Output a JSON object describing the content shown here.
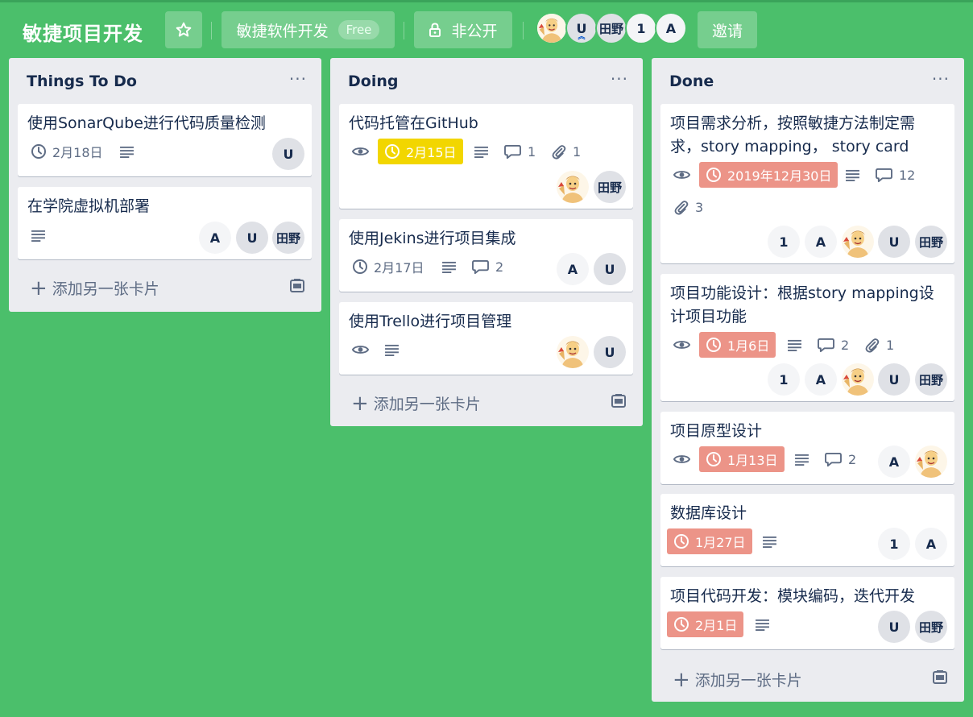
{
  "header": {
    "board_title": "敏捷项目开发",
    "star_icon": "star-icon",
    "team_name": "敏捷软件开发",
    "team_plan": "Free",
    "visibility": "非公开",
    "members": [
      "U",
      "田野",
      "1",
      "A"
    ],
    "invite_label": "邀请"
  },
  "lists": [
    {
      "title": "Things To Do",
      "menu": "···",
      "add_card": "添加另一张卡片",
      "cards": [
        {
          "title": "使用SonarQube进行代码质量检测",
          "due": "2月18日",
          "members": [
            "U"
          ]
        },
        {
          "title": "在学院虚拟机部署",
          "members": [
            "A",
            "U",
            "田野"
          ]
        }
      ]
    },
    {
      "title": "Doing",
      "menu": "···",
      "add_card": "添加另一张卡片",
      "cards": [
        {
          "title": "代码托管在GitHub",
          "due": "2月15日",
          "comments": "1",
          "attachments": "1",
          "members": [
            "田野"
          ]
        },
        {
          "title": "使用Jekins进行项目集成",
          "due": "2月17日",
          "comments": "2",
          "members": [
            "A",
            "U"
          ]
        },
        {
          "title": "使用Trello进行项目管理",
          "members": [
            "U"
          ]
        }
      ]
    },
    {
      "title": "Done",
      "menu": "···",
      "add_card": "添加另一张卡片",
      "cards": [
        {
          "title_line1": "项目需求分析，按照敏捷方法制定需",
          "title_line2": "求，story mapping， story card",
          "due": "2019年12月30日",
          "comments": "12",
          "attachments": "3",
          "members": [
            "1",
            "A",
            "U",
            "田野"
          ]
        },
        {
          "title_line1": "项目功能设计：根据story mapping设",
          "title_line2": "计项目功能",
          "due": "1月6日",
          "comments": "2",
          "attachments": "1",
          "members": [
            "1",
            "A",
            "U",
            "田野"
          ]
        },
        {
          "title": "项目原型设计",
          "due": "1月13日",
          "comments": "2",
          "members": [
            "A"
          ]
        },
        {
          "title": "数据库设计",
          "due": "1月27日",
          "members": [
            "1",
            "A"
          ]
        },
        {
          "title": "项目代码开发：模块编码，迭代开发",
          "due": "2月1日",
          "members": [
            "U",
            "田野"
          ]
        }
      ]
    }
  ],
  "colors": {
    "background": "#4bbf6b",
    "due_yellow": "#f2d600",
    "due_overdue": "#ec9488",
    "list_bg": "#ebecf0"
  }
}
